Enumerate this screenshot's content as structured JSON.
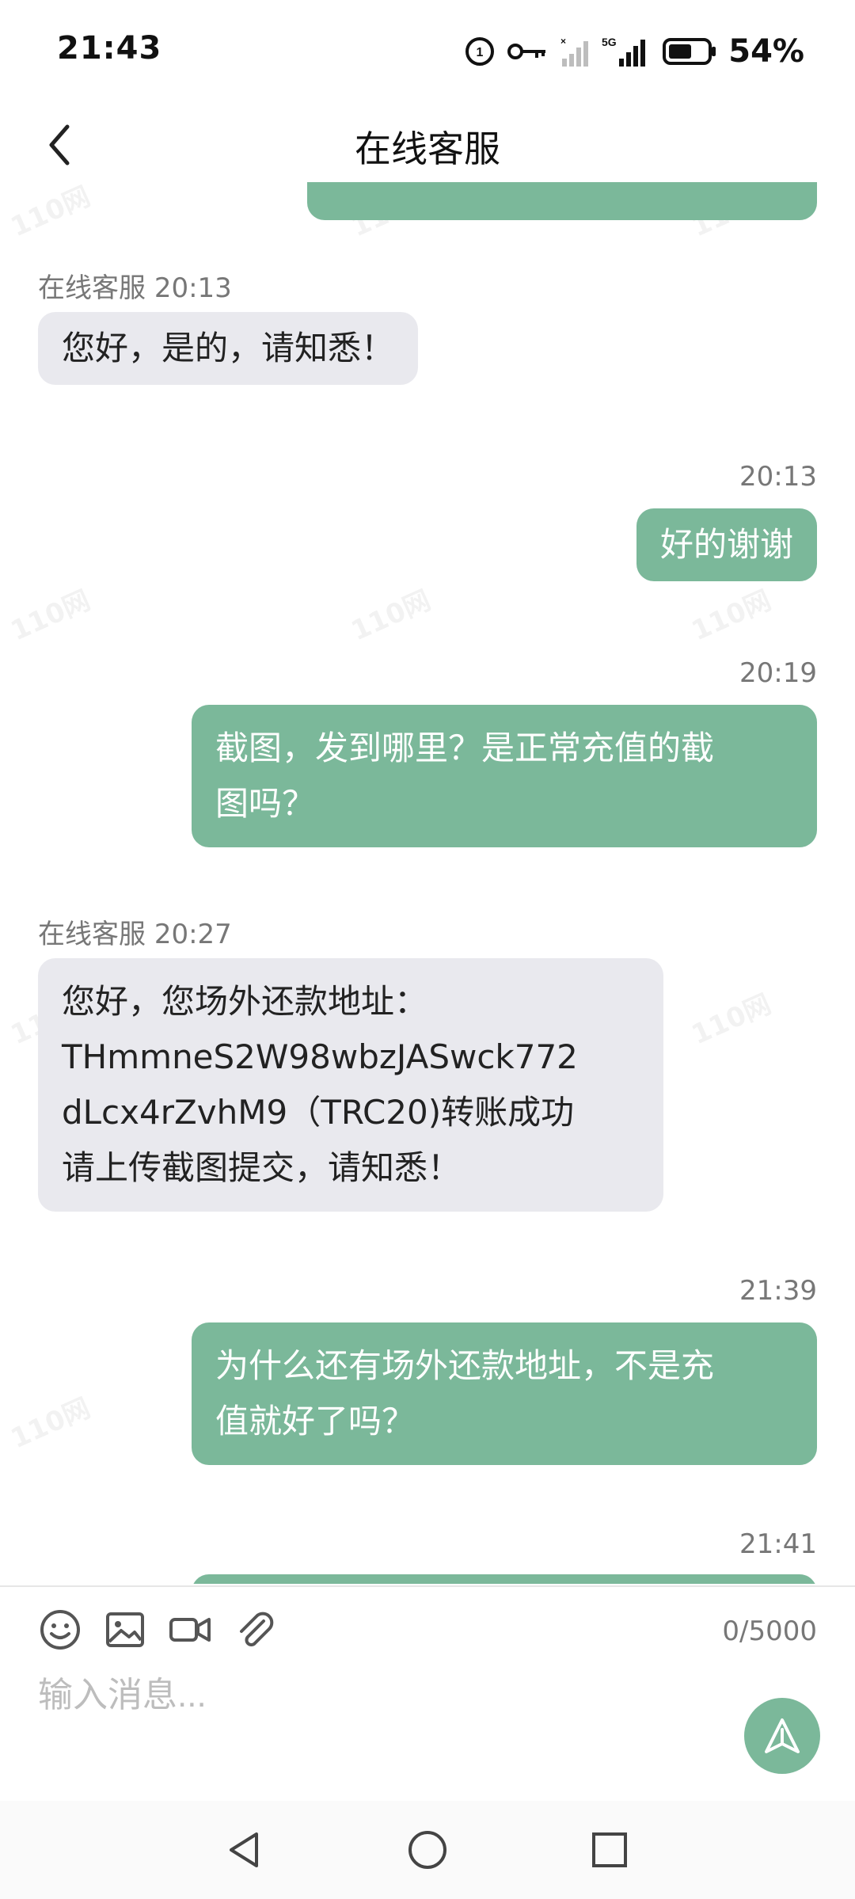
{
  "status_bar": {
    "time": "21:43",
    "network": "5G",
    "battery": "54%"
  },
  "header": {
    "title": "在线客服",
    "back_icon": "chevron-left-icon"
  },
  "messages": [
    {
      "id": "m0",
      "direction": "out",
      "text": ""
    },
    {
      "id": "m1",
      "direction": "in",
      "sender": "在线客服",
      "time": "20:13",
      "lines": [
        "您好，是的，请知悉！"
      ]
    },
    {
      "id": "m2",
      "direction": "out",
      "time": "20:13",
      "lines": [
        "好的谢谢"
      ]
    },
    {
      "id": "m3",
      "direction": "out",
      "time": "20:19",
      "lines": [
        "截图，发到哪里？是正常充值的截",
        "图吗？"
      ]
    },
    {
      "id": "m4",
      "direction": "in",
      "sender": "在线客服",
      "time": "20:27",
      "lines": [
        "您好，您场外还款地址：",
        "THmmneS2W98wbzJASwck772",
        "dLcx4rZvhM9（TRC20)转账成功",
        "请上传截图提交，请知悉！"
      ]
    },
    {
      "id": "m5",
      "direction": "out",
      "time": "21:39",
      "lines": [
        "为什么还有场外还款地址，不是充",
        "值就好了吗？"
      ]
    },
    {
      "id": "m6",
      "direction": "out",
      "time": "21:41",
      "lines": []
    }
  ],
  "input": {
    "placeholder": "输入消息...",
    "char_count": "0/5000",
    "tools": [
      "emoji-icon",
      "image-icon",
      "video-icon",
      "attachment-icon"
    ],
    "send_icon": "send-icon"
  },
  "watermark": "110网",
  "colors": {
    "outgoing_bubble": "#7bb89a",
    "incoming_bubble": "#e9e9ee",
    "accent": "#7bb89a"
  }
}
